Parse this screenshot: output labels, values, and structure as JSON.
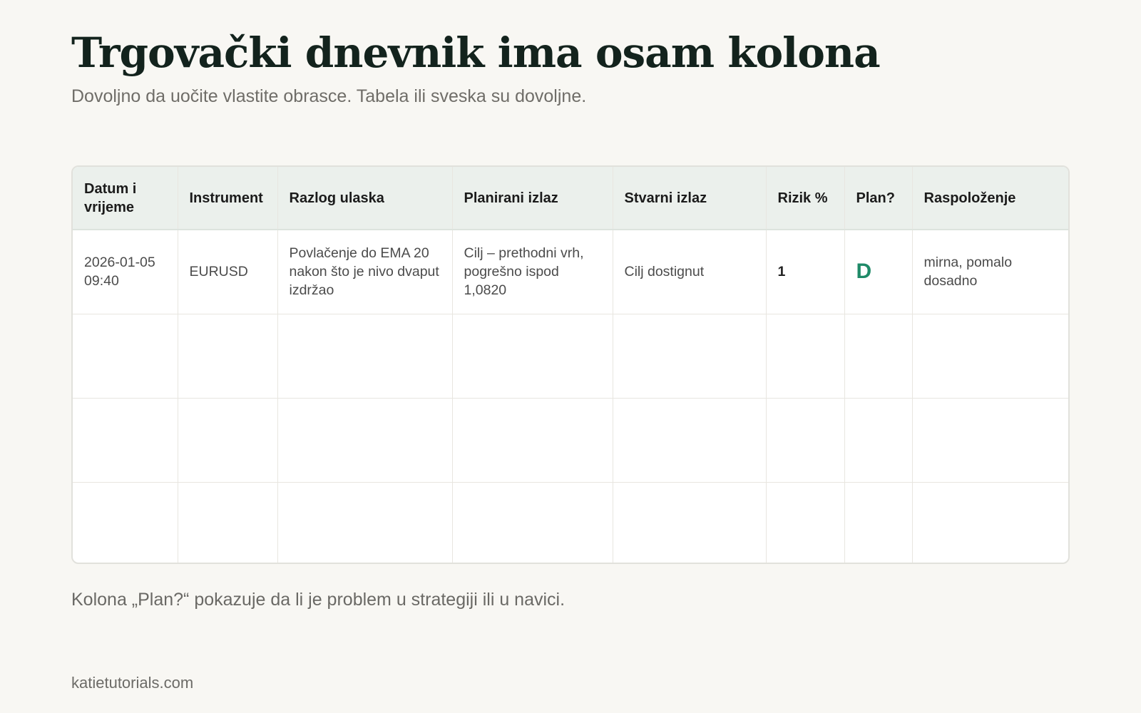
{
  "title": "Trgovački dnevnik ima osam kolona",
  "subtitle": "Dovoljno da uočite vlastite obrasce. Tabela ili sveska su dovoljne.",
  "table": {
    "headers": [
      "Datum i vrijeme",
      "Instrument",
      "Razlog ulaska",
      "Planirani izlaz",
      "Stvarni izlaz",
      "Rizik %",
      "Plan?",
      "Raspoloženje"
    ],
    "rows": [
      [
        "2026-01-05 09:40",
        "EURUSD",
        "Povlačenje do EMA 20 nakon što je nivo dvaput izdržao",
        "Cilj – prethodni vrh, pogrešno ispod 1,0820",
        "Cilj dostignut",
        "1",
        "D",
        "mirna, pomalo dosadno"
      ],
      [
        "",
        "",
        "",
        "",
        "",
        "",
        "",
        ""
      ],
      [
        "",
        "",
        "",
        "",
        "",
        "",
        "",
        ""
      ],
      [
        "",
        "",
        "",
        "",
        "",
        "",
        "",
        ""
      ]
    ]
  },
  "colors": {
    "background": "#f8f7f3",
    "header_bg": "#ebf0ec",
    "plan_accent": "#1f8a68"
  },
  "footnote": "Kolona „Plan?“ pokazuje da li je problem u strategiji ili u navici.",
  "site": "katietutorials.com"
}
